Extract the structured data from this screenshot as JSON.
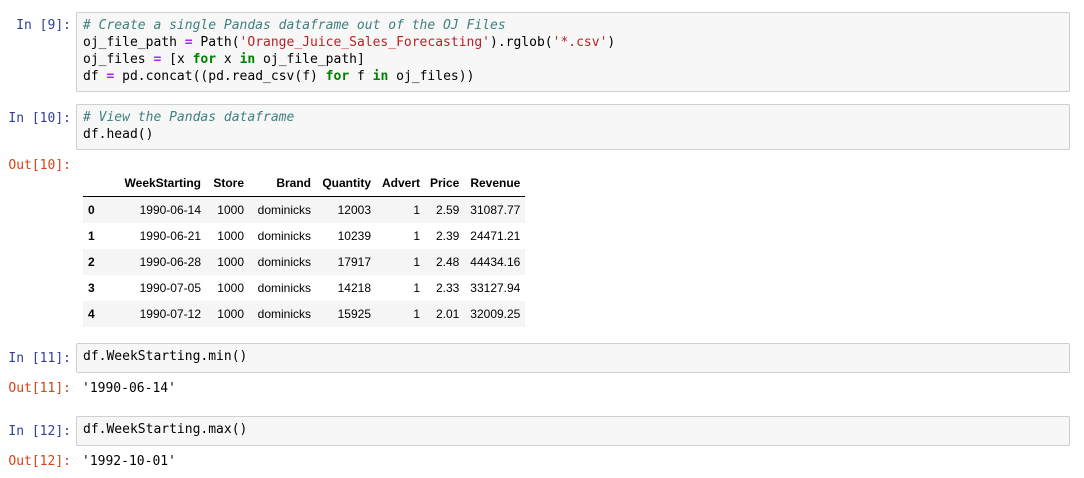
{
  "cells": [
    {
      "in_prompt": "In [9]:",
      "code": [
        "# Create a single Pandas dataframe out of the OJ Files",
        "oj_file_path = Path('Orange_Juice_Sales_Forecasting').rglob('*.csv')",
        "oj_files = [x for x in oj_file_path]",
        "df = pd.concat((pd.read_csv(f) for f in oj_files))"
      ]
    },
    {
      "in_prompt": "In [10]:",
      "code": [
        "# View the Pandas dataframe",
        "df.head()"
      ],
      "out_prompt": "Out[10]:",
      "table": {
        "columns": [
          "",
          "WeekStarting",
          "Store",
          "Brand",
          "Quantity",
          "Advert",
          "Price",
          "Revenue"
        ],
        "rows": [
          [
            "0",
            "1990-06-14",
            "1000",
            "dominicks",
            "12003",
            "1",
            "2.59",
            "31087.77"
          ],
          [
            "1",
            "1990-06-21",
            "1000",
            "dominicks",
            "10239",
            "1",
            "2.39",
            "24471.21"
          ],
          [
            "2",
            "1990-06-28",
            "1000",
            "dominicks",
            "17917",
            "1",
            "2.48",
            "44434.16"
          ],
          [
            "3",
            "1990-07-05",
            "1000",
            "dominicks",
            "14218",
            "1",
            "2.33",
            "33127.94"
          ],
          [
            "4",
            "1990-07-12",
            "1000",
            "dominicks",
            "15925",
            "1",
            "2.01",
            "32009.25"
          ]
        ]
      }
    },
    {
      "in_prompt": "In [11]:",
      "code": [
        "df.WeekStarting.min()"
      ],
      "out_prompt": "Out[11]:",
      "output": "'1990-06-14'"
    },
    {
      "in_prompt": "In [12]:",
      "code": [
        "df.WeekStarting.max()"
      ],
      "out_prompt": "Out[12]:",
      "output": "'1992-10-01'"
    }
  ]
}
